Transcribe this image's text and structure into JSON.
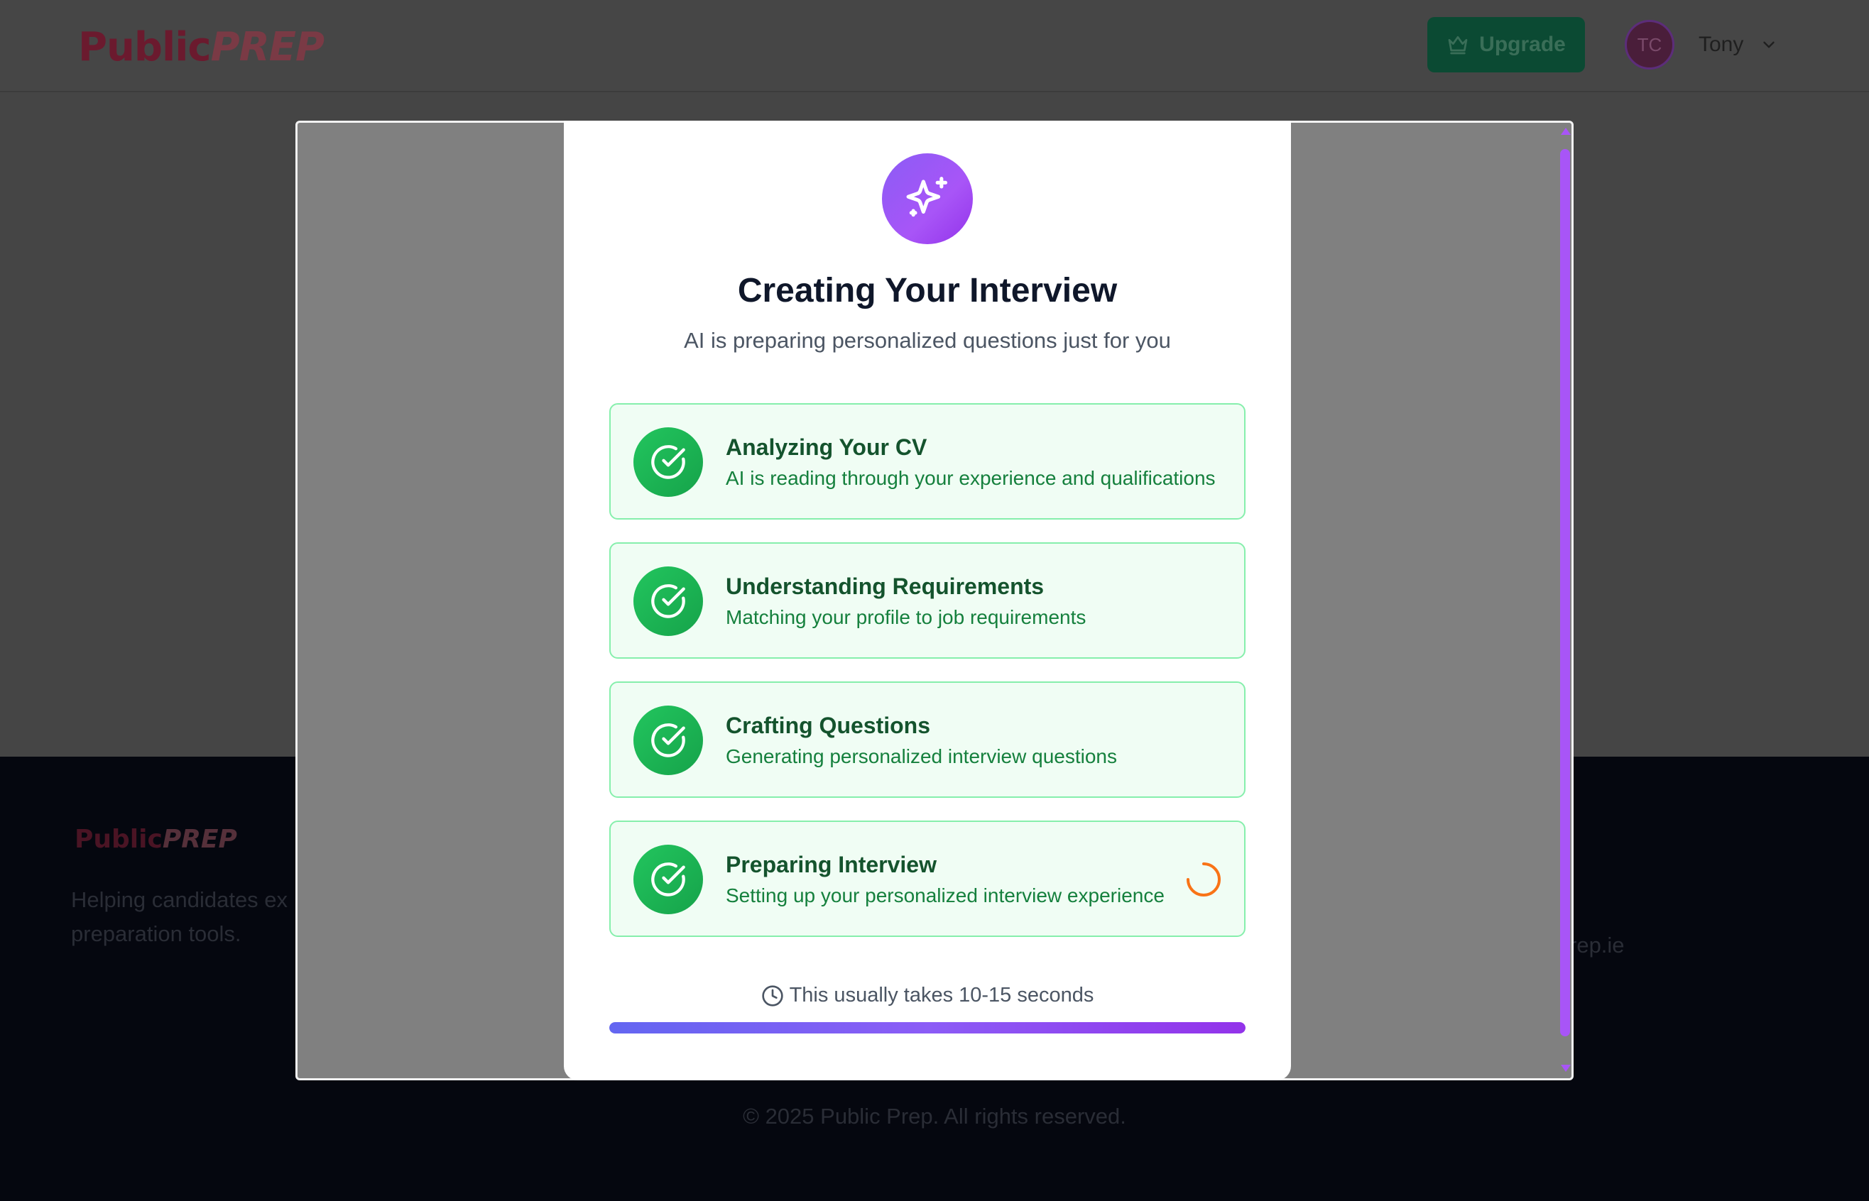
{
  "header": {
    "logo_part1": "Public",
    "logo_part2": "PREP",
    "upgrade_label": "Upgrade",
    "avatar_initials": "TC",
    "user_name": "Tony"
  },
  "footer": {
    "logo_part1": "Public",
    "logo_part2": "PREP",
    "tagline": "Helping candidates ex\npreparation tools.",
    "email_fragment": "rep.ie",
    "copyright": "© 2025 Public Prep. All rights reserved."
  },
  "modal": {
    "title": "Creating Your Interview",
    "subtitle": "AI is preparing personalized questions just for you",
    "steps": [
      {
        "title": "Analyzing Your CV",
        "desc": "AI is reading through your experience and qualifications",
        "status": "done"
      },
      {
        "title": "Understanding Requirements",
        "desc": "Matching your profile to job requirements",
        "status": "done"
      },
      {
        "title": "Crafting Questions",
        "desc": "Generating personalized interview questions",
        "status": "done"
      },
      {
        "title": "Preparing Interview",
        "desc": "Setting up your personalized interview experience",
        "status": "in-progress"
      }
    ],
    "eta_text": "This usually takes 10-15 seconds",
    "progress_percent": 100
  },
  "icons": {
    "header_sparkle": "sparkles-icon",
    "step_done": "check-circle-icon",
    "step_loading": "spinner-icon",
    "eta": "clock-icon",
    "upgrade": "crown-icon",
    "user_menu": "chevron-down-icon"
  },
  "colors": {
    "accent_purple": "#a855f7",
    "success_green": "#22c55e",
    "spinner_orange": "#f97316",
    "step_bg": "#f0fdf4"
  }
}
